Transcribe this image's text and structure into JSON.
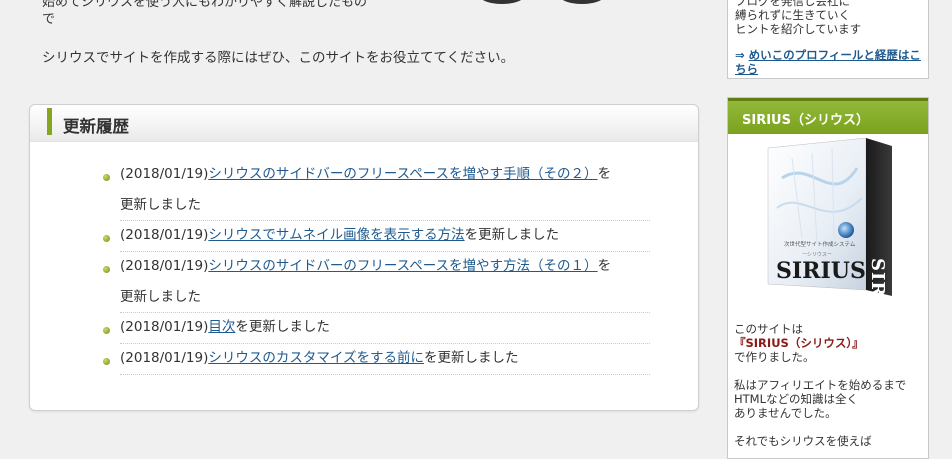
{
  "intro": {
    "cut_line1": "始めてシリウスを使う人にもわかりやすく解説したもの",
    "cut_line2": "で",
    "text": "シリウスでサイトを作成する際にはぜひ、このサイトをお役立ててください。"
  },
  "updates": {
    "title": "更新履歴",
    "items": [
      {
        "date": "(2018/01/19)",
        "link": "シリウスのサイドバーのフリースペースを増やす手順（その２）",
        "suffix": "を",
        "line2": "更新しました"
      },
      {
        "date": "(2018/01/19)",
        "link": "シリウスでサムネイル画像を表示する方法",
        "suffix": "を更新しました",
        "line2": ""
      },
      {
        "date": "(2018/01/19)",
        "link": "シリウスのサイドバーのフリースペースを増やす方法（その１）",
        "suffix": "を",
        "line2": "更新しました"
      },
      {
        "date": "(2018/01/19)",
        "link": "目次",
        "suffix": "を更新しました",
        "line2": ""
      },
      {
        "date": "(2018/01/19)",
        "link": "シリウスのカスタマイズをする前に",
        "suffix": "を更新しました",
        "line2": ""
      }
    ]
  },
  "sidebar": {
    "profile": {
      "cut_line1": "ブログを発信し会社に",
      "line2": "縛られずに生きていく",
      "line3": "ヒントを紹介しています",
      "arrow": "⇒",
      "link": "めいこのプロフィールと経歴はこちら"
    },
    "sirius": {
      "title": "SIRIUS（シリウス）",
      "product_label": "SIRIUS",
      "product_sub": "次世代型サイト作成システム",
      "product_kana": "ーシリウスー",
      "text1": "このサイトは",
      "text_bold": "『SIRIUS（シリウス）』",
      "text2": "で作りました。",
      "text3": "私はアフィリエイトを始めるまで",
      "text4": "HTMLなどの知識は全く",
      "text5": "ありませんでした。",
      "text6": "それでもシリウスを使えば"
    }
  },
  "colors": {
    "accent_green": "#86a521",
    "link": "#1f5a8f",
    "sirius_bold": "#8a1a1a"
  }
}
